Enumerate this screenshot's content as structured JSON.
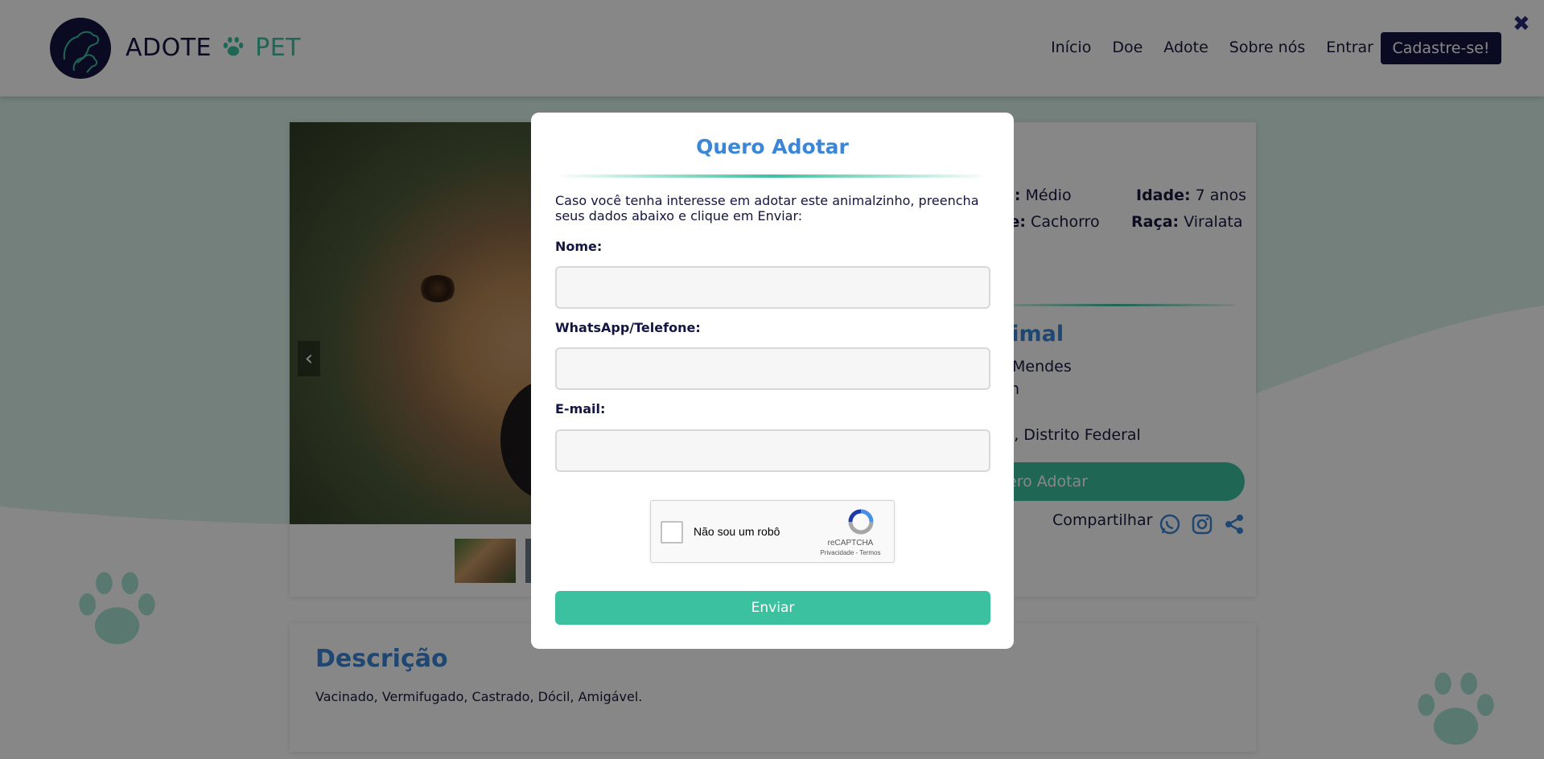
{
  "header": {
    "logo_main": "ADOTE",
    "logo_accent": "PET",
    "nav": [
      "Início",
      "Doe",
      "Adote",
      "Sobre nós",
      "Entrar"
    ],
    "signup_label": "Cadastre-se!"
  },
  "pet": {
    "porte_label": "e:",
    "porte_value": "Médio",
    "idade_label": "Idade:",
    "idade_value": "7 anos",
    "especie_label": "ie:",
    "especie_value": "Cachorro",
    "raca_label": "Raça:",
    "raca_value": "Viralata"
  },
  "owner": {
    "section_title": "nimal",
    "name": "Mendes",
    "line2": "n",
    "location": "lia, Distrito Federal"
  },
  "adopt_button_partial": "ero Adotar",
  "share_label": "Compartilhar",
  "description": {
    "title": "Descrição",
    "text": "Vacinado, Vermifugado, Castrado, Dócil, Amigável."
  },
  "modal": {
    "title": "Quero Adotar",
    "intro": "Caso você tenha interesse em adotar este animalzinho, preencha seus dados abaixo e clique em Enviar:",
    "name_label": "Nome:",
    "phone_label": "WhatsApp/Telefone:",
    "email_label": "E-mail:",
    "recaptcha_label": "Não sou um robô",
    "recaptcha_brand": "reCAPTCHA",
    "recaptcha_links": "Privacidade - Termos",
    "submit_label": "Enviar",
    "close_symbol": "✖"
  },
  "carousel_prev": "‹",
  "colors": {
    "brand_dark": "#141540",
    "accent_green": "#3cc1a0",
    "title_blue": "#3d86d6"
  }
}
